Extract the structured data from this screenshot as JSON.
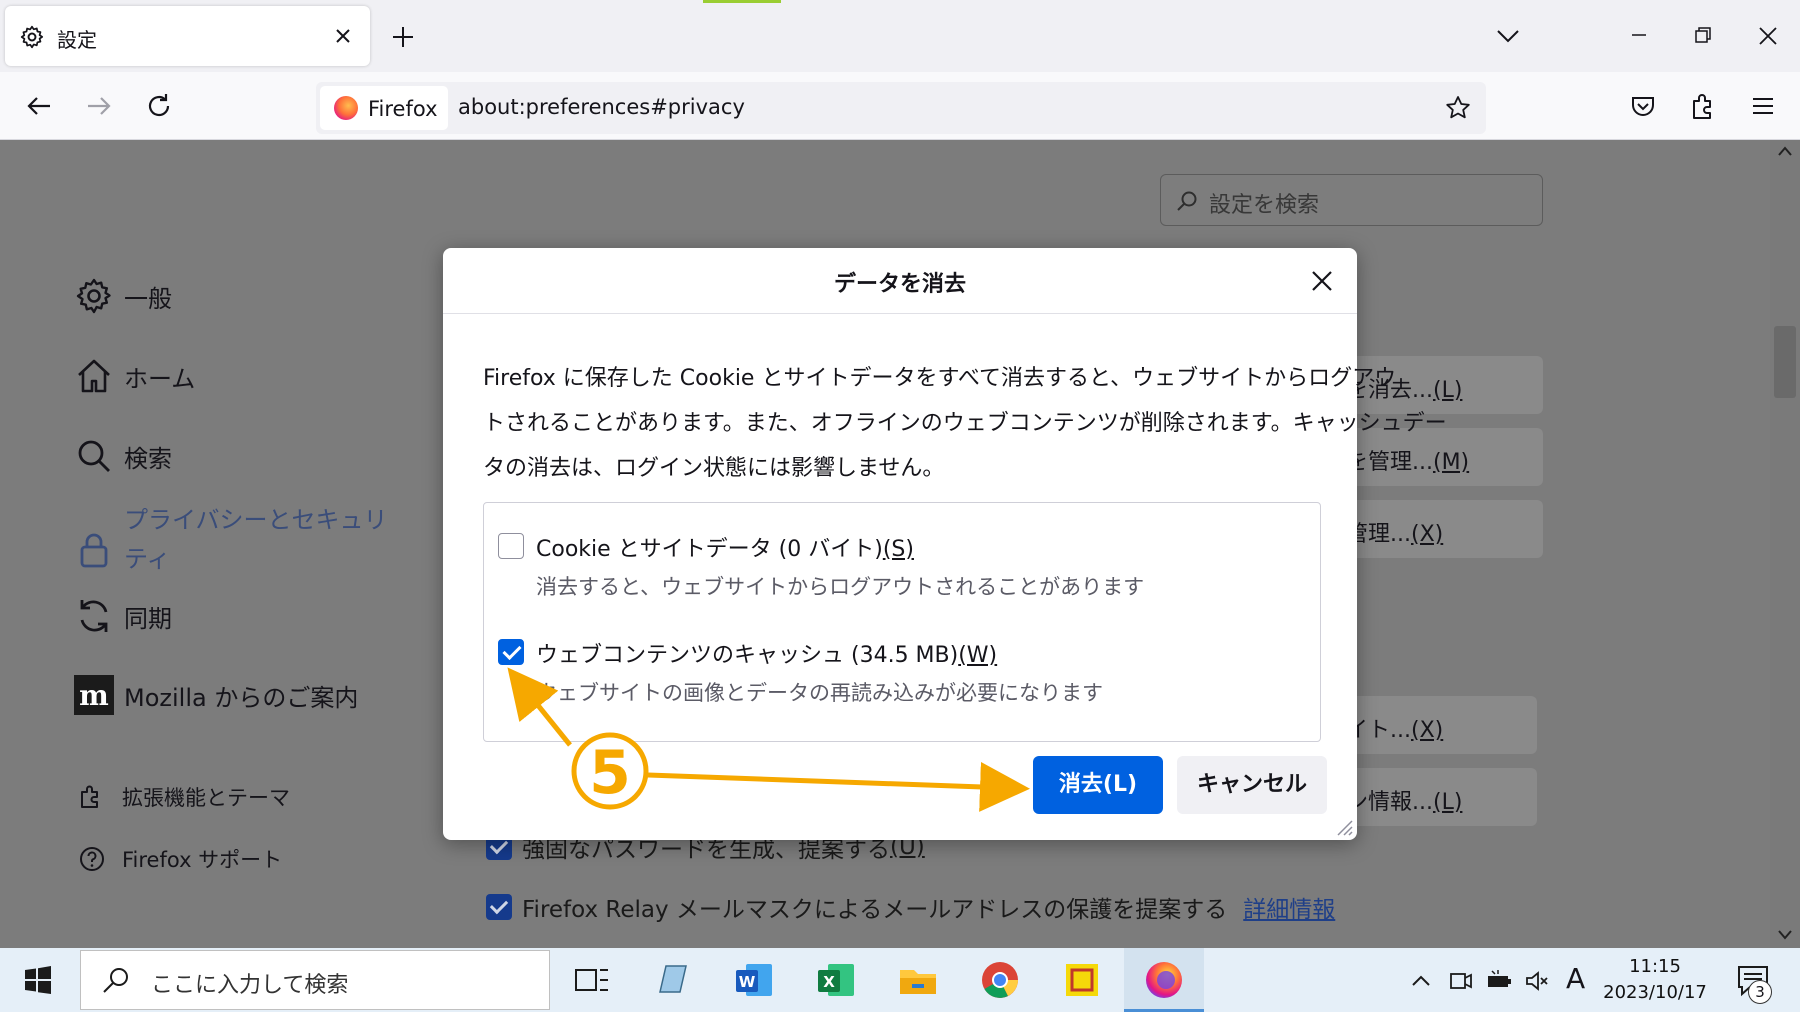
{
  "tab": {
    "title": "設定"
  },
  "urlbar": {
    "identity_label": "Firefox",
    "url": "about:preferences#privacy"
  },
  "settings_search": {
    "placeholder": "設定を検索"
  },
  "sidebar": {
    "items": [
      {
        "label": "一般",
        "icon": "gear-icon"
      },
      {
        "label": "ホーム",
        "icon": "home-icon"
      },
      {
        "label": "検索",
        "icon": "search-icon"
      },
      {
        "label": "プライバシーとセキュリティ",
        "label_line1": "プライバシーとセキュリ",
        "label_line2": "ティ",
        "icon": "lock-icon",
        "active": true
      },
      {
        "label": "同期",
        "icon": "sync-icon"
      },
      {
        "label": "Mozilla からのご案内",
        "icon": "mozilla-icon"
      }
    ],
    "footer": [
      {
        "label": "拡張機能とテーマ",
        "icon": "puzzle-icon"
      },
      {
        "label": "Firefox サポート",
        "icon": "help-icon"
      }
    ]
  },
  "background_buttons": [
    {
      "label": "ータを消去...",
      "shortcut": "(L)"
    },
    {
      "label": "ータを管理...",
      "shortcut": "(M)"
    },
    {
      "label": "外を管理...",
      "shortcut": "(X)"
    },
    {
      "label": "外サイト...",
      "shortcut": "(X)"
    },
    {
      "label": "グイン情報...",
      "shortcut": "(L)"
    }
  ],
  "background_checks": [
    {
      "label": "強固なパスワードを生成、提案する",
      "shortcut": "(U)"
    },
    {
      "label": "Firefox Relay メールマスクによるメールアドレスの保護を提案する",
      "link": "詳細情報"
    }
  ],
  "dialog": {
    "title": "データを消去",
    "description": "Firefox に保存した Cookie とサイトデータをすべて消去すると、ウェブサイトからログアウトされることがあります。また、オフラインのウェブコンテンツが削除されます。キャッシュデータの消去は、ログイン状態には影響しません。",
    "desc_line1": "Firefox に保存した Cookie とサイトデータをすべて消去すると、ウェブサイトからログアウ",
    "desc_line2": "トされることがあります。また、オフラインのウェブコンテンツが削除されます。キャッシュデー",
    "desc_line3": "タの消去は、ログイン状態には影響しません。",
    "options": [
      {
        "label": "Cookie とサイトデータ (0 バイト)",
        "shortcut": "(S)",
        "description": "消去すると、ウェブサイトからログアウトされることがあります",
        "checked": false
      },
      {
        "label": "ウェブコンテンツのキャッシュ (34.5 MB)",
        "shortcut": "(W)",
        "description": "ウェブサイトの画像とデータの再読み込みが必要になります",
        "checked": true
      }
    ],
    "clear_button": "消去(L)",
    "cancel_button": "キャンセル"
  },
  "annotation": {
    "step_number": "5",
    "color": "#f6a800"
  },
  "taskbar": {
    "search_placeholder": "ここに入力して検索",
    "ime_indicator": "A",
    "time": "11:15",
    "date": "2023/10/17",
    "notification_count": "3"
  },
  "colors": {
    "accent": "#0061e0",
    "annotation": "#f6a800"
  }
}
